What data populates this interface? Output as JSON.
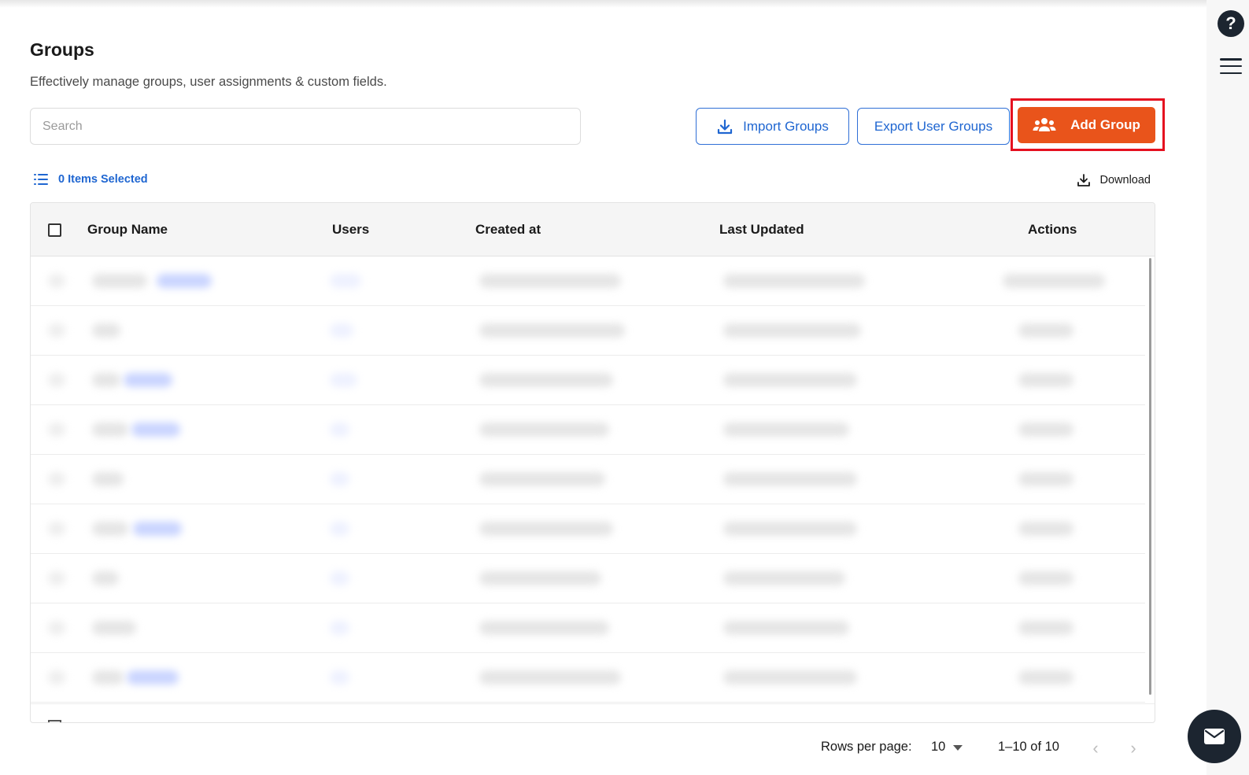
{
  "header": {
    "title": "Groups",
    "subtitle": "Effectively manage groups, user assignments & custom fields."
  },
  "search": {
    "placeholder": "Search",
    "value": ""
  },
  "toolbar": {
    "import_label": "Import Groups",
    "export_label": "Export User Groups",
    "add_label": "Add Group"
  },
  "selection": {
    "label": "0 Items Selected"
  },
  "download": {
    "label": "Download"
  },
  "table": {
    "columns": [
      "Group Name",
      "Users",
      "Created at",
      "Last Updated",
      "Actions"
    ]
  },
  "pagination": {
    "rows_per_page_label": "Rows per page:",
    "rows_per_page_value": "10",
    "range": "1–10 of 10"
  },
  "colors": {
    "primary_blue": "#1f66d1",
    "add_button": "#e9541b",
    "highlight_border": "#e5101f",
    "dark": "#1c2530"
  },
  "icons": {
    "help": "question-mark-icon",
    "menu": "hamburger-menu-icon",
    "import": "download-tray-icon",
    "add": "users-group-icon",
    "list": "list-icon",
    "download": "download-tray-icon",
    "mail": "envelope-icon"
  }
}
